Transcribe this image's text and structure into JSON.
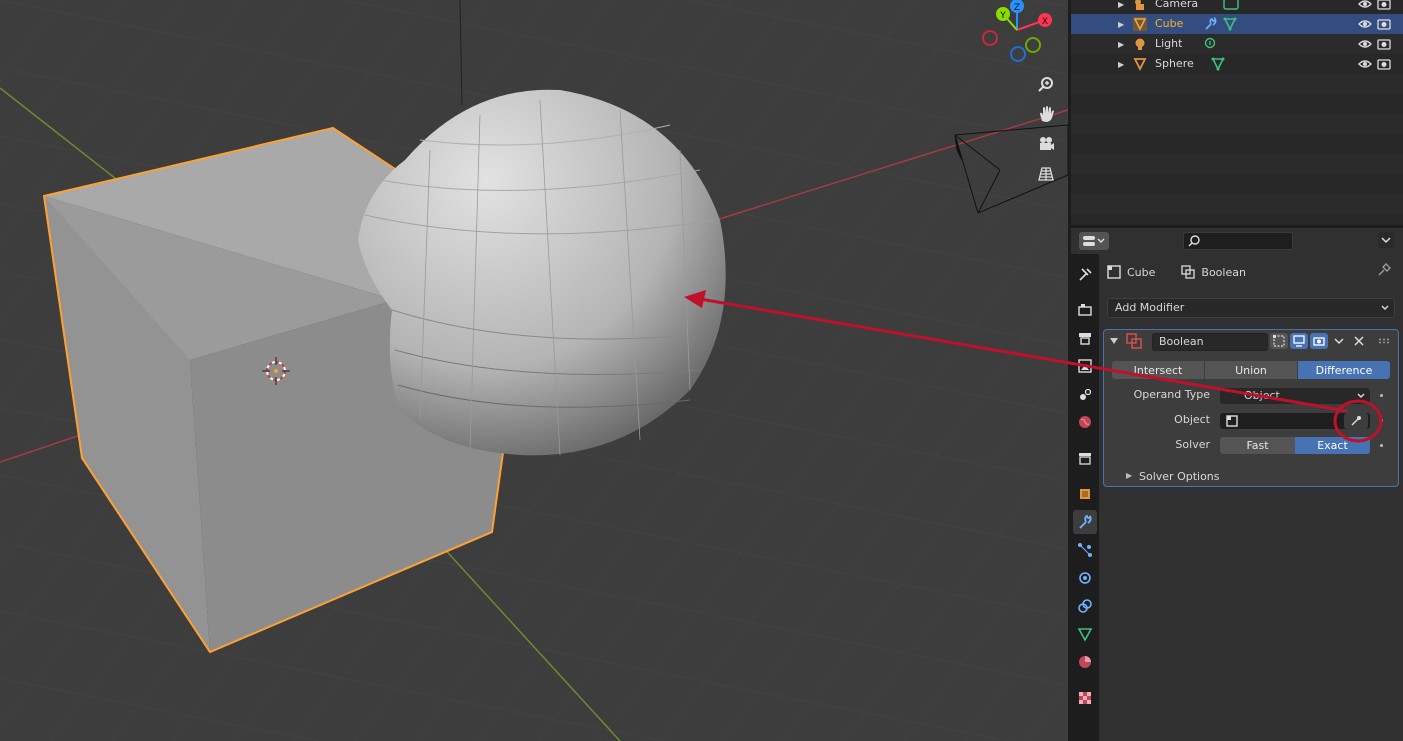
{
  "outliner": {
    "rows": [
      {
        "name": "Camera",
        "selected": false
      },
      {
        "name": "Cube",
        "selected": true
      },
      {
        "name": "Light",
        "selected": false
      },
      {
        "name": "Sphere",
        "selected": false
      }
    ]
  },
  "properties": {
    "breadcrumb": {
      "object": "Cube",
      "modifier": "Boolean"
    },
    "add_modifier_label": "Add Modifier",
    "modifier": {
      "name": "Boolean",
      "operations": [
        "Intersect",
        "Union",
        "Difference"
      ],
      "active_operation": "Difference",
      "operand_type_label": "Operand Type",
      "operand_type_value": "Object",
      "object_label": "Object",
      "object_value": "",
      "solver_label": "Solver",
      "solver_options": [
        "Fast",
        "Exact"
      ],
      "active_solver": "Exact",
      "solver_options_label": "Solver Options"
    }
  },
  "gizmo": {
    "x_label": "X",
    "y_label": "Y",
    "z_label": "Z"
  },
  "colors": {
    "selection_orange": "#ffa033",
    "active_blue": "#4772b3",
    "annotation_red": "#c0102a",
    "x_axis": "#ff3352",
    "y_axis": "#8bdc00",
    "z_axis": "#2890ff"
  },
  "annotation": {
    "description_icon": "eyedropper-icon"
  }
}
